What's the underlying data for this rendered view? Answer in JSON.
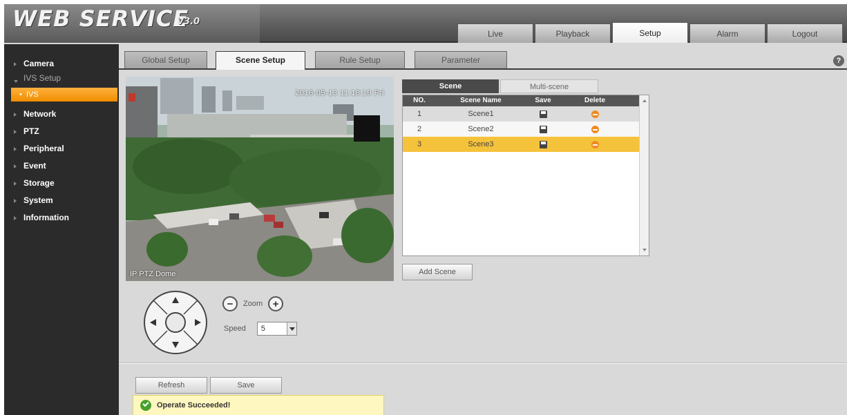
{
  "brand": {
    "logo": "WEB SERVICE",
    "version": "V3.0"
  },
  "top_nav": {
    "live": "Live",
    "playback": "Playback",
    "setup": "Setup",
    "alarm": "Alarm",
    "logout": "Logout"
  },
  "sidebar": {
    "camera": "Camera",
    "ivs_setup": "IVS Setup",
    "ivs": "IVS",
    "network": "Network",
    "ptz": "PTZ",
    "peripheral": "Peripheral",
    "event": "Event",
    "storage": "Storage",
    "system": "System",
    "information": "Information"
  },
  "subtabs": {
    "global": "Global Setup",
    "scene": "Scene Setup",
    "rule": "Rule Setup",
    "parameter": "Parameter"
  },
  "help": "?",
  "video": {
    "osd_time": "2016-05-13 11:18:19 Fri",
    "osd_title": "IP PTZ Dome"
  },
  "scene_tabs": {
    "scene": "Scene",
    "multi": "Multi-scene"
  },
  "scene_table": {
    "headers": {
      "no": "NO.",
      "name": "Scene Name",
      "save": "Save",
      "delete": "Delete"
    },
    "rows": [
      {
        "no": "1",
        "name": "Scene1"
      },
      {
        "no": "2",
        "name": "Scene2"
      },
      {
        "no": "3",
        "name": "Scene3"
      }
    ],
    "selected_row": 3
  },
  "buttons": {
    "add_scene": "Add Scene",
    "refresh": "Refresh",
    "save": "Save"
  },
  "ptz": {
    "zoom_label": "Zoom",
    "speed_label": "Speed",
    "speed_value": "5"
  },
  "status": {
    "message": "Operate Succeeded!"
  },
  "colors": {
    "accent_orange": "#f08d00",
    "selected_row": "#f5c23c",
    "success_green": "#48a12f"
  }
}
